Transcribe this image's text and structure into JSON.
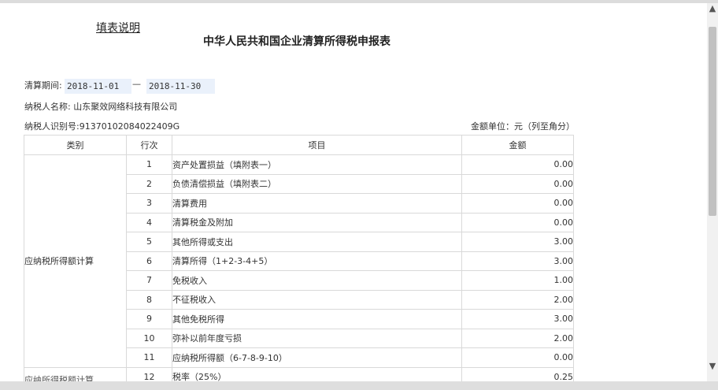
{
  "header": {
    "instructions_link": "填表说明",
    "title": "中华人民共和国企业清算所得税申报表"
  },
  "period": {
    "label": "清算期间:",
    "start": "2018-11-01",
    "separator": "—",
    "end": "2018-11-30"
  },
  "taxpayer": {
    "name_line": "纳税人名称: 山东聚效网络科技有限公司",
    "id_line": "纳税人识别号:91370102084022409G"
  },
  "unit_note": "金额单位：元（列至角分）",
  "table": {
    "headers": [
      "类别",
      "行次",
      "项目",
      "金额"
    ],
    "category1": "应纳税所得额计算",
    "category2_partial": "应纳所得税额计算",
    "rows": [
      {
        "no": "1",
        "item": "资产处置损益（填附表一）",
        "amount": "0.00"
      },
      {
        "no": "2",
        "item": "负债清偿损益（填附表二）",
        "amount": "0.00"
      },
      {
        "no": "3",
        "item": "清算费用",
        "amount": "0.00"
      },
      {
        "no": "4",
        "item": "清算税金及附加",
        "amount": "0.00"
      },
      {
        "no": "5",
        "item": "其他所得或支出",
        "amount": "3.00"
      },
      {
        "no": "6",
        "item": "清算所得（1+2-3-4+5）",
        "amount": "3.00"
      },
      {
        "no": "7",
        "item": "免税收入",
        "amount": "1.00"
      },
      {
        "no": "8",
        "item": "不征税收入",
        "amount": "2.00"
      },
      {
        "no": "9",
        "item": "其他免税所得",
        "amount": "3.00"
      },
      {
        "no": "10",
        "item": "弥补以前年度亏损",
        "amount": "2.00"
      },
      {
        "no": "11",
        "item": "应纳税所得额（6-7-8-9-10）",
        "amount": "0.00"
      },
      {
        "no": "12",
        "item": "税率（25%）",
        "amount": "0.25"
      }
    ]
  },
  "scrollbar": {
    "up_icon": "▲",
    "down_icon": "▼"
  }
}
